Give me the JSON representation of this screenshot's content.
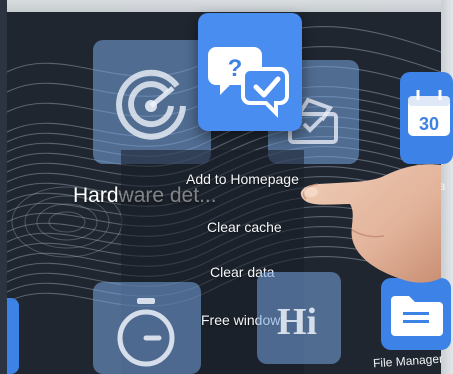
{
  "context_menu": {
    "items": [
      {
        "label": "Add to Homepage"
      },
      {
        "label": "Clear cache"
      },
      {
        "label": "Clear data"
      },
      {
        "label": "Free window"
      }
    ]
  },
  "app_labels": {
    "hardware_visible": "Hard",
    "hardware_faded": "ware det...",
    "file_manager": "File Manager",
    "calendar_partial": "da"
  },
  "calendar_day": "30",
  "hi_tile_text": "Hi",
  "colors": {
    "tile_blue": "#3d82e6",
    "tile_highlight": "#4a8df0",
    "wallpaper": "#1f2630",
    "menu_text": "#f4f6f8"
  },
  "icons": {
    "hardware": "radar-scan-icon",
    "selected_app": "help-chat-bubbles-icon",
    "vote": "ballot-box-icon",
    "calendar": "calendar-icon",
    "timer": "stopwatch-icon",
    "file_manager": "folder-icon"
  }
}
